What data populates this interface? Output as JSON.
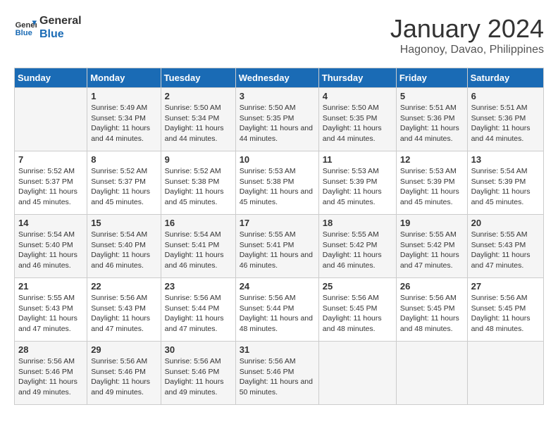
{
  "logo": {
    "line1": "General",
    "line2": "Blue"
  },
  "title": "January 2024",
  "location": "Hagonoy, Davao, Philippines",
  "weekdays": [
    "Sunday",
    "Monday",
    "Tuesday",
    "Wednesday",
    "Thursday",
    "Friday",
    "Saturday"
  ],
  "weeks": [
    [
      {
        "day": "",
        "sunrise": "",
        "sunset": "",
        "daylight": ""
      },
      {
        "day": "1",
        "sunrise": "Sunrise: 5:49 AM",
        "sunset": "Sunset: 5:34 PM",
        "daylight": "Daylight: 11 hours and 44 minutes."
      },
      {
        "day": "2",
        "sunrise": "Sunrise: 5:50 AM",
        "sunset": "Sunset: 5:34 PM",
        "daylight": "Daylight: 11 hours and 44 minutes."
      },
      {
        "day": "3",
        "sunrise": "Sunrise: 5:50 AM",
        "sunset": "Sunset: 5:35 PM",
        "daylight": "Daylight: 11 hours and 44 minutes."
      },
      {
        "day": "4",
        "sunrise": "Sunrise: 5:50 AM",
        "sunset": "Sunset: 5:35 PM",
        "daylight": "Daylight: 11 hours and 44 minutes."
      },
      {
        "day": "5",
        "sunrise": "Sunrise: 5:51 AM",
        "sunset": "Sunset: 5:36 PM",
        "daylight": "Daylight: 11 hours and 44 minutes."
      },
      {
        "day": "6",
        "sunrise": "Sunrise: 5:51 AM",
        "sunset": "Sunset: 5:36 PM",
        "daylight": "Daylight: 11 hours and 44 minutes."
      }
    ],
    [
      {
        "day": "7",
        "sunrise": "Sunrise: 5:52 AM",
        "sunset": "Sunset: 5:37 PM",
        "daylight": "Daylight: 11 hours and 45 minutes."
      },
      {
        "day": "8",
        "sunrise": "Sunrise: 5:52 AM",
        "sunset": "Sunset: 5:37 PM",
        "daylight": "Daylight: 11 hours and 45 minutes."
      },
      {
        "day": "9",
        "sunrise": "Sunrise: 5:52 AM",
        "sunset": "Sunset: 5:38 PM",
        "daylight": "Daylight: 11 hours and 45 minutes."
      },
      {
        "day": "10",
        "sunrise": "Sunrise: 5:53 AM",
        "sunset": "Sunset: 5:38 PM",
        "daylight": "Daylight: 11 hours and 45 minutes."
      },
      {
        "day": "11",
        "sunrise": "Sunrise: 5:53 AM",
        "sunset": "Sunset: 5:39 PM",
        "daylight": "Daylight: 11 hours and 45 minutes."
      },
      {
        "day": "12",
        "sunrise": "Sunrise: 5:53 AM",
        "sunset": "Sunset: 5:39 PM",
        "daylight": "Daylight: 11 hours and 45 minutes."
      },
      {
        "day": "13",
        "sunrise": "Sunrise: 5:54 AM",
        "sunset": "Sunset: 5:39 PM",
        "daylight": "Daylight: 11 hours and 45 minutes."
      }
    ],
    [
      {
        "day": "14",
        "sunrise": "Sunrise: 5:54 AM",
        "sunset": "Sunset: 5:40 PM",
        "daylight": "Daylight: 11 hours and 46 minutes."
      },
      {
        "day": "15",
        "sunrise": "Sunrise: 5:54 AM",
        "sunset": "Sunset: 5:40 PM",
        "daylight": "Daylight: 11 hours and 46 minutes."
      },
      {
        "day": "16",
        "sunrise": "Sunrise: 5:54 AM",
        "sunset": "Sunset: 5:41 PM",
        "daylight": "Daylight: 11 hours and 46 minutes."
      },
      {
        "day": "17",
        "sunrise": "Sunrise: 5:55 AM",
        "sunset": "Sunset: 5:41 PM",
        "daylight": "Daylight: 11 hours and 46 minutes."
      },
      {
        "day": "18",
        "sunrise": "Sunrise: 5:55 AM",
        "sunset": "Sunset: 5:42 PM",
        "daylight": "Daylight: 11 hours and 46 minutes."
      },
      {
        "day": "19",
        "sunrise": "Sunrise: 5:55 AM",
        "sunset": "Sunset: 5:42 PM",
        "daylight": "Daylight: 11 hours and 47 minutes."
      },
      {
        "day": "20",
        "sunrise": "Sunrise: 5:55 AM",
        "sunset": "Sunset: 5:43 PM",
        "daylight": "Daylight: 11 hours and 47 minutes."
      }
    ],
    [
      {
        "day": "21",
        "sunrise": "Sunrise: 5:55 AM",
        "sunset": "Sunset: 5:43 PM",
        "daylight": "Daylight: 11 hours and 47 minutes."
      },
      {
        "day": "22",
        "sunrise": "Sunrise: 5:56 AM",
        "sunset": "Sunset: 5:43 PM",
        "daylight": "Daylight: 11 hours and 47 minutes."
      },
      {
        "day": "23",
        "sunrise": "Sunrise: 5:56 AM",
        "sunset": "Sunset: 5:44 PM",
        "daylight": "Daylight: 11 hours and 47 minutes."
      },
      {
        "day": "24",
        "sunrise": "Sunrise: 5:56 AM",
        "sunset": "Sunset: 5:44 PM",
        "daylight": "Daylight: 11 hours and 48 minutes."
      },
      {
        "day": "25",
        "sunrise": "Sunrise: 5:56 AM",
        "sunset": "Sunset: 5:45 PM",
        "daylight": "Daylight: 11 hours and 48 minutes."
      },
      {
        "day": "26",
        "sunrise": "Sunrise: 5:56 AM",
        "sunset": "Sunset: 5:45 PM",
        "daylight": "Daylight: 11 hours and 48 minutes."
      },
      {
        "day": "27",
        "sunrise": "Sunrise: 5:56 AM",
        "sunset": "Sunset: 5:45 PM",
        "daylight": "Daylight: 11 hours and 48 minutes."
      }
    ],
    [
      {
        "day": "28",
        "sunrise": "Sunrise: 5:56 AM",
        "sunset": "Sunset: 5:46 PM",
        "daylight": "Daylight: 11 hours and 49 minutes."
      },
      {
        "day": "29",
        "sunrise": "Sunrise: 5:56 AM",
        "sunset": "Sunset: 5:46 PM",
        "daylight": "Daylight: 11 hours and 49 minutes."
      },
      {
        "day": "30",
        "sunrise": "Sunrise: 5:56 AM",
        "sunset": "Sunset: 5:46 PM",
        "daylight": "Daylight: 11 hours and 49 minutes."
      },
      {
        "day": "31",
        "sunrise": "Sunrise: 5:56 AM",
        "sunset": "Sunset: 5:46 PM",
        "daylight": "Daylight: 11 hours and 50 minutes."
      },
      {
        "day": "",
        "sunrise": "",
        "sunset": "",
        "daylight": ""
      },
      {
        "day": "",
        "sunrise": "",
        "sunset": "",
        "daylight": ""
      },
      {
        "day": "",
        "sunrise": "",
        "sunset": "",
        "daylight": ""
      }
    ]
  ]
}
